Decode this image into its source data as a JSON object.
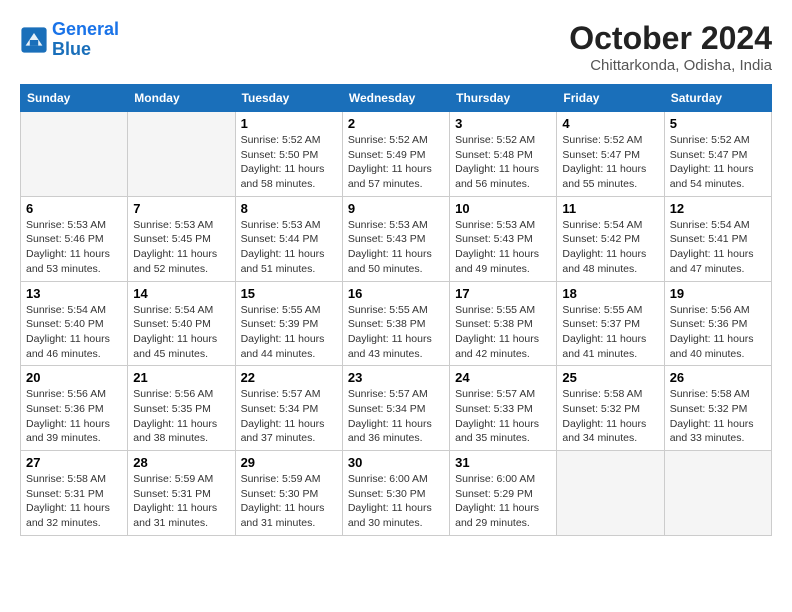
{
  "header": {
    "logo_line1": "General",
    "logo_line2": "Blue",
    "month": "October 2024",
    "location": "Chittarkonda, Odisha, India"
  },
  "weekdays": [
    "Sunday",
    "Monday",
    "Tuesday",
    "Wednesday",
    "Thursday",
    "Friday",
    "Saturday"
  ],
  "weeks": [
    [
      {
        "day": "",
        "info": ""
      },
      {
        "day": "",
        "info": ""
      },
      {
        "day": "1",
        "info": "Sunrise: 5:52 AM\nSunset: 5:50 PM\nDaylight: 11 hours\nand 58 minutes."
      },
      {
        "day": "2",
        "info": "Sunrise: 5:52 AM\nSunset: 5:49 PM\nDaylight: 11 hours\nand 57 minutes."
      },
      {
        "day": "3",
        "info": "Sunrise: 5:52 AM\nSunset: 5:48 PM\nDaylight: 11 hours\nand 56 minutes."
      },
      {
        "day": "4",
        "info": "Sunrise: 5:52 AM\nSunset: 5:47 PM\nDaylight: 11 hours\nand 55 minutes."
      },
      {
        "day": "5",
        "info": "Sunrise: 5:52 AM\nSunset: 5:47 PM\nDaylight: 11 hours\nand 54 minutes."
      }
    ],
    [
      {
        "day": "6",
        "info": "Sunrise: 5:53 AM\nSunset: 5:46 PM\nDaylight: 11 hours\nand 53 minutes."
      },
      {
        "day": "7",
        "info": "Sunrise: 5:53 AM\nSunset: 5:45 PM\nDaylight: 11 hours\nand 52 minutes."
      },
      {
        "day": "8",
        "info": "Sunrise: 5:53 AM\nSunset: 5:44 PM\nDaylight: 11 hours\nand 51 minutes."
      },
      {
        "day": "9",
        "info": "Sunrise: 5:53 AM\nSunset: 5:43 PM\nDaylight: 11 hours\nand 50 minutes."
      },
      {
        "day": "10",
        "info": "Sunrise: 5:53 AM\nSunset: 5:43 PM\nDaylight: 11 hours\nand 49 minutes."
      },
      {
        "day": "11",
        "info": "Sunrise: 5:54 AM\nSunset: 5:42 PM\nDaylight: 11 hours\nand 48 minutes."
      },
      {
        "day": "12",
        "info": "Sunrise: 5:54 AM\nSunset: 5:41 PM\nDaylight: 11 hours\nand 47 minutes."
      }
    ],
    [
      {
        "day": "13",
        "info": "Sunrise: 5:54 AM\nSunset: 5:40 PM\nDaylight: 11 hours\nand 46 minutes."
      },
      {
        "day": "14",
        "info": "Sunrise: 5:54 AM\nSunset: 5:40 PM\nDaylight: 11 hours\nand 45 minutes."
      },
      {
        "day": "15",
        "info": "Sunrise: 5:55 AM\nSunset: 5:39 PM\nDaylight: 11 hours\nand 44 minutes."
      },
      {
        "day": "16",
        "info": "Sunrise: 5:55 AM\nSunset: 5:38 PM\nDaylight: 11 hours\nand 43 minutes."
      },
      {
        "day": "17",
        "info": "Sunrise: 5:55 AM\nSunset: 5:38 PM\nDaylight: 11 hours\nand 42 minutes."
      },
      {
        "day": "18",
        "info": "Sunrise: 5:55 AM\nSunset: 5:37 PM\nDaylight: 11 hours\nand 41 minutes."
      },
      {
        "day": "19",
        "info": "Sunrise: 5:56 AM\nSunset: 5:36 PM\nDaylight: 11 hours\nand 40 minutes."
      }
    ],
    [
      {
        "day": "20",
        "info": "Sunrise: 5:56 AM\nSunset: 5:36 PM\nDaylight: 11 hours\nand 39 minutes."
      },
      {
        "day": "21",
        "info": "Sunrise: 5:56 AM\nSunset: 5:35 PM\nDaylight: 11 hours\nand 38 minutes."
      },
      {
        "day": "22",
        "info": "Sunrise: 5:57 AM\nSunset: 5:34 PM\nDaylight: 11 hours\nand 37 minutes."
      },
      {
        "day": "23",
        "info": "Sunrise: 5:57 AM\nSunset: 5:34 PM\nDaylight: 11 hours\nand 36 minutes."
      },
      {
        "day": "24",
        "info": "Sunrise: 5:57 AM\nSunset: 5:33 PM\nDaylight: 11 hours\nand 35 minutes."
      },
      {
        "day": "25",
        "info": "Sunrise: 5:58 AM\nSunset: 5:32 PM\nDaylight: 11 hours\nand 34 minutes."
      },
      {
        "day": "26",
        "info": "Sunrise: 5:58 AM\nSunset: 5:32 PM\nDaylight: 11 hours\nand 33 minutes."
      }
    ],
    [
      {
        "day": "27",
        "info": "Sunrise: 5:58 AM\nSunset: 5:31 PM\nDaylight: 11 hours\nand 32 minutes."
      },
      {
        "day": "28",
        "info": "Sunrise: 5:59 AM\nSunset: 5:31 PM\nDaylight: 11 hours\nand 31 minutes."
      },
      {
        "day": "29",
        "info": "Sunrise: 5:59 AM\nSunset: 5:30 PM\nDaylight: 11 hours\nand 31 minutes."
      },
      {
        "day": "30",
        "info": "Sunrise: 6:00 AM\nSunset: 5:30 PM\nDaylight: 11 hours\nand 30 minutes."
      },
      {
        "day": "31",
        "info": "Sunrise: 6:00 AM\nSunset: 5:29 PM\nDaylight: 11 hours\nand 29 minutes."
      },
      {
        "day": "",
        "info": ""
      },
      {
        "day": "",
        "info": ""
      }
    ]
  ]
}
